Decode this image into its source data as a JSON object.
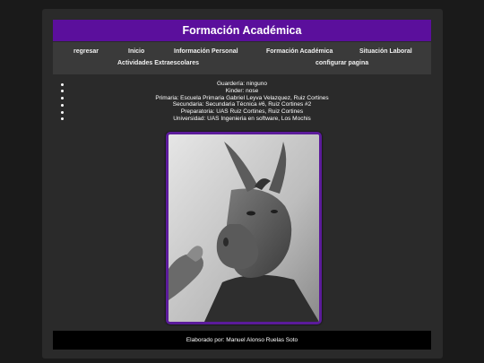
{
  "header": {
    "title": "Formación Académica"
  },
  "nav": {
    "row1": [
      "regresar",
      "Inicio",
      "Información Personal",
      "Formación Académica",
      "Situación Laboral"
    ],
    "row2": [
      "Actividades Extraescolares",
      "configurar pagina"
    ]
  },
  "education": [
    "Guardería: ninguno",
    "Kinder: nose",
    "Primaria: Escuela Primaria Gabriel Leyva Velazquez, Ruiz Cortines",
    "Secundaria: Secundaria Técnica #6, Ruiz Cortines #2",
    "Preparatoria: UAS Ruiz Cortines, Ruiz Cortines",
    "Universidad: UAS Ingenieria en software, Los Mochis"
  ],
  "footer": {
    "text": "Elaborado por: Manuel Alonso Ruelas Soto"
  },
  "colors": {
    "accent": "#5b0f9c",
    "page_bg": "#2a2a2a",
    "nav_bg": "#3a3a3a",
    "footer_bg": "#000000"
  }
}
